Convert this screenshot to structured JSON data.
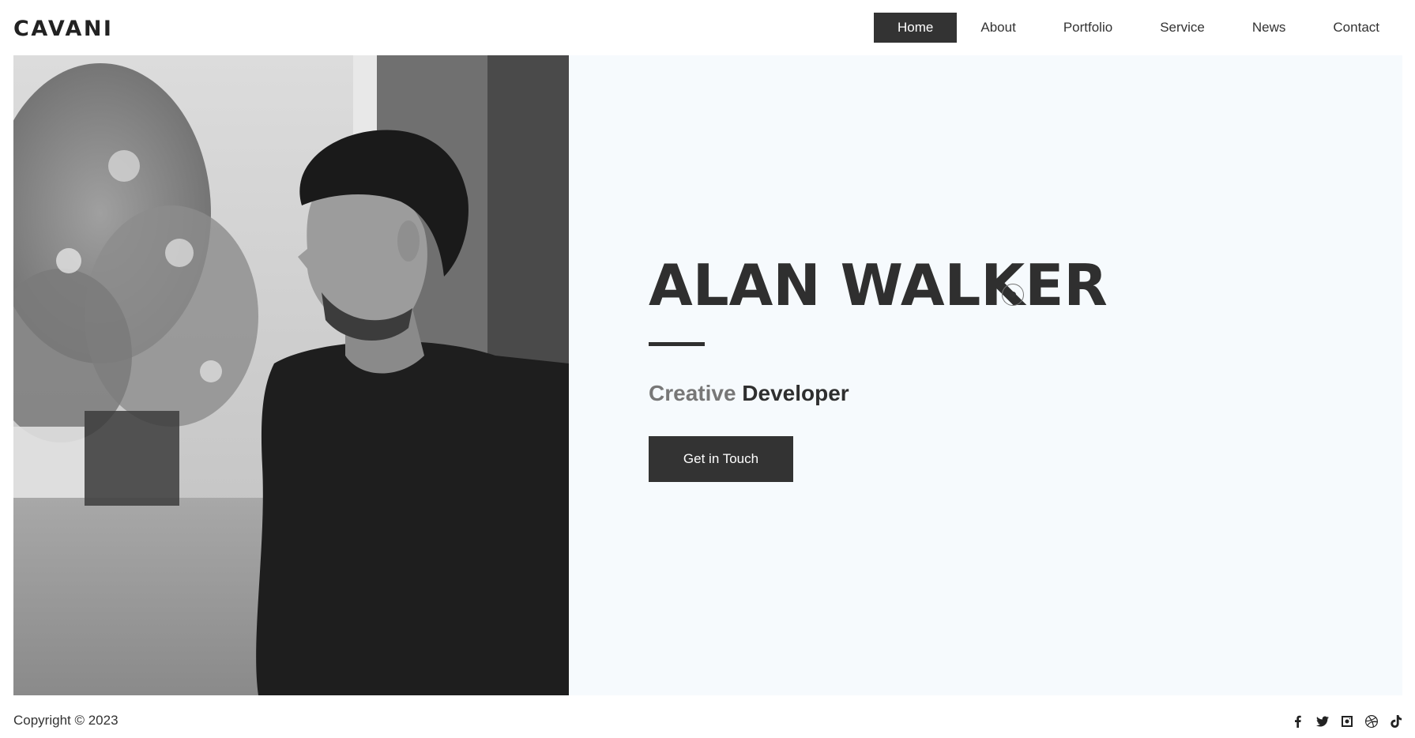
{
  "header": {
    "logo": "CAVANI",
    "nav": [
      {
        "label": "Home",
        "active": true
      },
      {
        "label": "About",
        "active": false
      },
      {
        "label": "Portfolio",
        "active": false
      },
      {
        "label": "Service",
        "active": false
      },
      {
        "label": "News",
        "active": false
      },
      {
        "label": "Contact",
        "active": false
      }
    ]
  },
  "hero": {
    "name": "ALAN WALKER",
    "job_light": "Creative",
    "job_bold": "Developer",
    "cta_label": "Get in Touch",
    "photo": "portrait-photo"
  },
  "footer": {
    "copyright": "Copyright © 2023",
    "social": [
      "facebook-icon",
      "twitter-icon",
      "instagram-icon",
      "dribbble-icon",
      "tiktok-icon"
    ]
  },
  "colors": {
    "accent": "#333333",
    "hero_bg": "#f6fafd",
    "text": "#333333",
    "muted": "#777777"
  }
}
